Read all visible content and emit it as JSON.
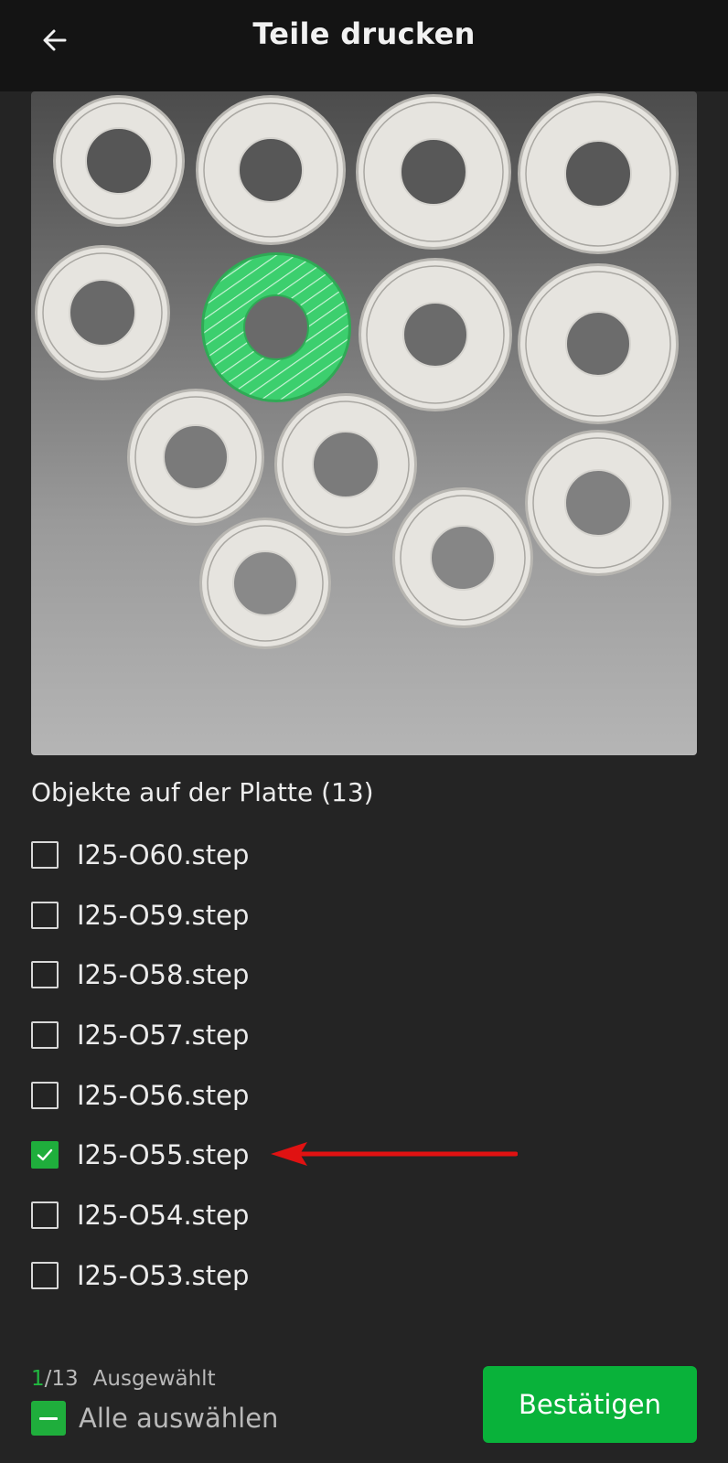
{
  "header": {
    "title": "Teile drucken",
    "back_icon": "arrow-left-icon"
  },
  "plate": {
    "part_count": 13,
    "selected_part_index": 5,
    "selected_color": "#3ccf6e",
    "part_color": "#e6e4df"
  },
  "objects": {
    "heading": "Objekte auf der Platte (13)",
    "items": [
      {
        "label": "I25-O60.step",
        "checked": false
      },
      {
        "label": "I25-O59.step",
        "checked": false
      },
      {
        "label": "I25-O58.step",
        "checked": false
      },
      {
        "label": "I25-O57.step",
        "checked": false
      },
      {
        "label": "I25-O56.step",
        "checked": false
      },
      {
        "label": "I25-O55.step",
        "checked": true
      },
      {
        "label": "I25-O54.step",
        "checked": false
      },
      {
        "label": "I25-O53.step",
        "checked": false
      }
    ]
  },
  "footer": {
    "selected_count": "1",
    "total": "/13",
    "selected_label": "Ausgewählt",
    "select_all_label": "Alle auswählen",
    "confirm_label": "Bestätigen",
    "accent_color": "#09b23a"
  },
  "annotation": {
    "arrow_color": "#e01212",
    "points_to": "I25-O55.step"
  }
}
